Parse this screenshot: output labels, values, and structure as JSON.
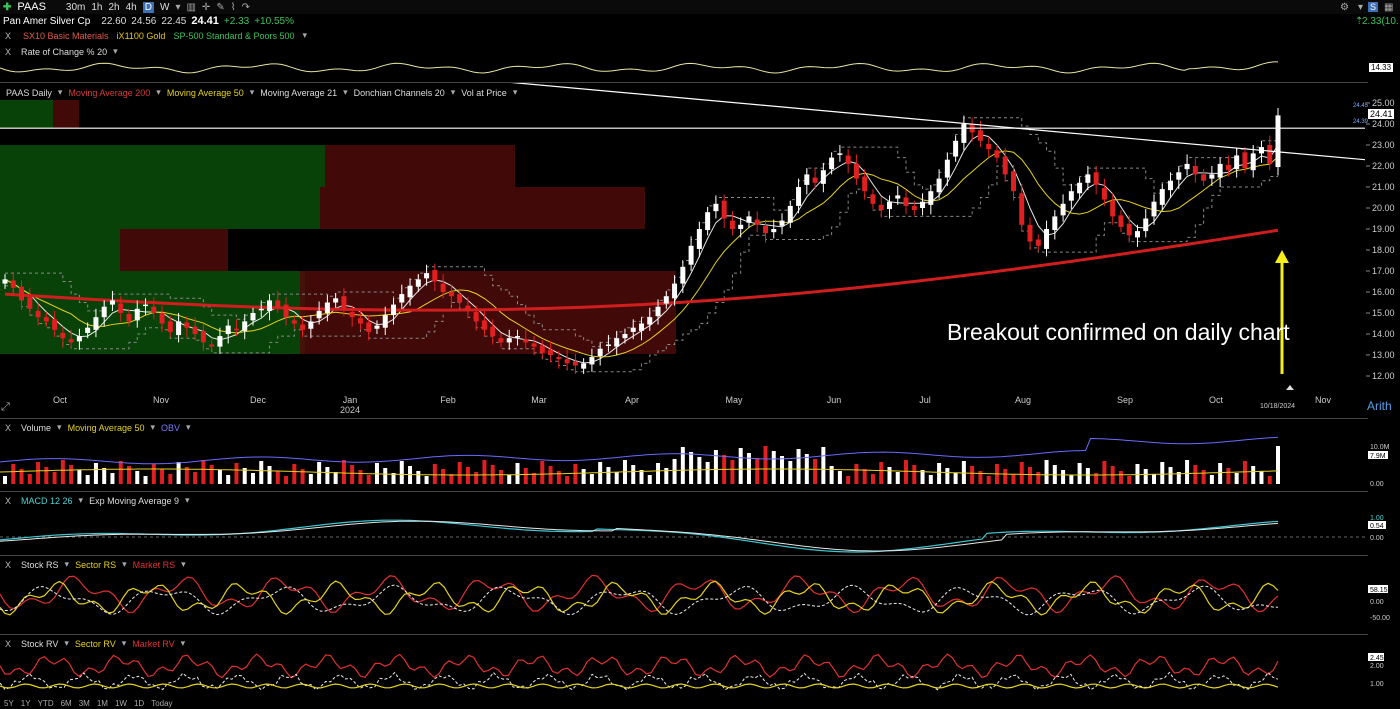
{
  "toolbar": {
    "symbol": "PAAS",
    "intervals": [
      "30m",
      "1h",
      "2h",
      "4h",
      "D",
      "W"
    ],
    "selected_interval": "D",
    "right_change": "2.33(10."
  },
  "quote": {
    "name": "Pan Amer Silver Cp",
    "open": "22.60",
    "high": "24.56",
    "low": "22.45",
    "close": "24.41",
    "change": "+2.33",
    "change_pct": "+10.55%"
  },
  "comparisons": {
    "items": [
      "SX10 Basic Materials",
      "iX1100 Gold",
      "SP-500 Standard & Poors 500"
    ],
    "colors": [
      "#e05a4a",
      "#e6c41a",
      "#3cc25a"
    ]
  },
  "roc_panel": {
    "label": "Rate of Change % 20",
    "value": "14.33"
  },
  "price_panel": {
    "labels": [
      "PAAS Daily",
      "Moving Average 200",
      "Moving Average 50",
      "Moving Average 21",
      "Donchian Channels 20",
      "Vol at Price"
    ],
    "label_colors": [
      "#dddddd",
      "#d83a3a",
      "#e6d21e",
      "#e6e6e6",
      "#dddddd",
      "#dddddd"
    ],
    "annotation": "Breakout confirmed on daily chart",
    "price_tag": "24.41",
    "tag_high": "24.45",
    "tag_low": "24.39",
    "current_date": "10/18/2024",
    "scale_mode": "Arith"
  },
  "volume_panel": {
    "labels": [
      "Volume",
      "Moving Average 50",
      "OBV"
    ],
    "label_colors": [
      "#dddddd",
      "#e6d21e",
      "#7b7bff"
    ],
    "ticks": [
      "10.0M",
      "7.9M",
      "0.00"
    ]
  },
  "macd_panel": {
    "labels": [
      "MACD 12 26",
      "Exp Moving Average 9"
    ],
    "label_colors": [
      "#4ad2d2",
      "#dddddd"
    ],
    "ticks": [
      "1.00",
      "0.54",
      "0.00"
    ]
  },
  "rs_panel": {
    "labels": [
      "Stock RS",
      "Sector RS",
      "Market RS"
    ],
    "label_colors": [
      "#dddddd",
      "#e6d21e",
      "#e03030"
    ],
    "ticks": [
      "58.15",
      "0.00",
      "-50.00"
    ]
  },
  "rv_panel": {
    "labels": [
      "Stock RV",
      "Sector RV",
      "Market RV"
    ],
    "label_colors": [
      "#dddddd",
      "#e6d21e",
      "#e03030"
    ],
    "ticks": [
      "2.45",
      "2.00",
      "1.00"
    ]
  },
  "range_buttons": [
    "5Y",
    "1Y",
    "YTD",
    "6M",
    "3M",
    "1M",
    "1W",
    "1D",
    "Today"
  ],
  "chart_data": {
    "type": "candlestick",
    "title": "PAAS Daily",
    "x": [
      "Sep",
      "Oct",
      "Nov",
      "Dec",
      "Jan 2024",
      "Feb",
      "Mar",
      "Apr",
      "May",
      "Jun",
      "Jul",
      "Aug",
      "Sep",
      "Oct",
      "Nov"
    ],
    "x_tick_labels": [
      "Oct",
      "Nov",
      "Dec",
      "Jan",
      "Feb",
      "Mar",
      "Apr",
      "May",
      "Jun",
      "Jul",
      "Aug",
      "Sep",
      "Oct",
      "Nov"
    ],
    "year_label": "2024",
    "ylim": [
      12.0,
      25.0
    ],
    "y_ticks": [
      12.0,
      13.0,
      14.0,
      15.0,
      16.0,
      17.0,
      18.0,
      19.0,
      20.0,
      21.0,
      22.0,
      23.0,
      24.0,
      25.0
    ],
    "closes": [
      16.6,
      16.2,
      15.6,
      15.2,
      14.8,
      14.6,
      14.2,
      13.8,
      13.6,
      13.9,
      14.3,
      14.8,
      15.3,
      15.6,
      15.0,
      14.6,
      15.2,
      15.4,
      15.0,
      14.5,
      14.1,
      14.6,
      14.3,
      14.0,
      13.6,
      13.4,
      13.9,
      14.4,
      14.2,
      14.6,
      15.0,
      15.2,
      15.6,
      15.3,
      14.8,
      14.5,
      14.2,
      14.6,
      15.1,
      15.5,
      15.7,
      15.2,
      14.8,
      14.5,
      14.1,
      14.4,
      14.9,
      15.4,
      15.9,
      16.3,
      16.6,
      16.9,
      16.5,
      16.0,
      15.8,
      15.5,
      15.1,
      14.6,
      14.2,
      13.9,
      13.6,
      13.8,
      13.9,
      13.6,
      13.4,
      13.1,
      13.0,
      12.8,
      12.6,
      12.5,
      12.6,
      12.9,
      13.3,
      13.5,
      13.8,
      14.0,
      14.3,
      14.5,
      14.8,
      15.3,
      15.8,
      16.4,
      17.2,
      18.2,
      19.0,
      19.8,
      20.2,
      19.5,
      19.0,
      19.2,
      19.6,
      19.2,
      18.8,
      19.0,
      19.4,
      20.1,
      21.0,
      21.6,
      21.2,
      21.8,
      22.4,
      22.6,
      22.1,
      21.4,
      20.8,
      20.2,
      19.9,
      20.3,
      20.6,
      20.1,
      19.9,
      20.3,
      20.8,
      21.4,
      22.3,
      23.2,
      24.0,
      23.6,
      23.2,
      22.8,
      22.4,
      21.6,
      20.8,
      19.2,
      18.4,
      18.2,
      19.0,
      19.6,
      20.2,
      20.8,
      21.2,
      21.6,
      21.1,
      20.4,
      19.6,
      19.1,
      18.7,
      18.9,
      19.5,
      20.3,
      20.9,
      21.3,
      21.7,
      22.1,
      21.6,
      21.3,
      21.6,
      22.1,
      21.8,
      22.5,
      21.9,
      22.6,
      22.9,
      22.1,
      24.41
    ],
    "ma200_end": 18.6,
    "resistance_line": {
      "from_date": "Feb",
      "from_value": 26.2,
      "to_date": "Nov",
      "to_value": 22.3
    },
    "horizontal_level": 23.8
  }
}
